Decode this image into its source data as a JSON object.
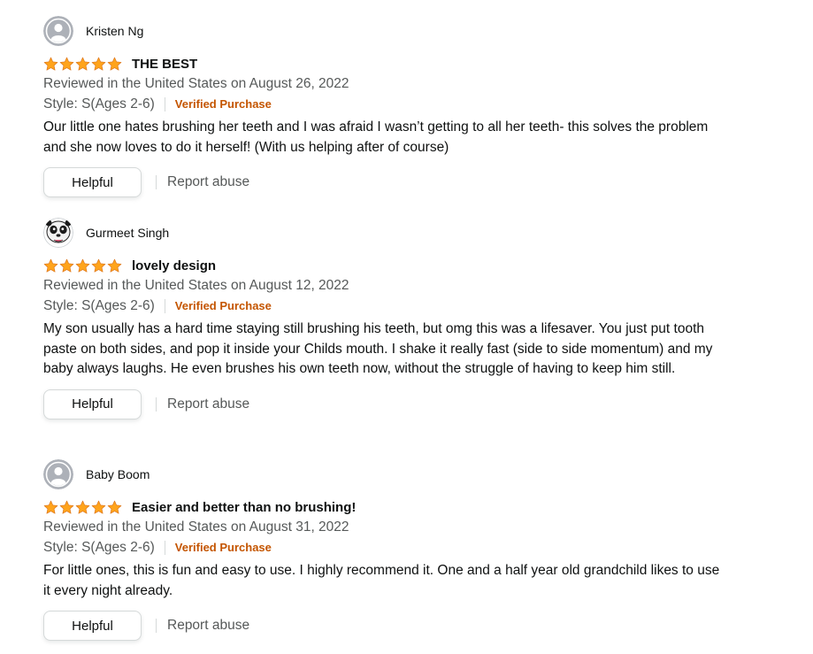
{
  "colors": {
    "star": "#ffa41c",
    "verified": "#c45500",
    "secondary_text": "#565959",
    "primary_text": "#0f1111"
  },
  "reviews": [
    {
      "profile_name": "Kristen Ng",
      "avatar_icon": "default-user-avatar-icon",
      "rating": 5,
      "rating_max": 5,
      "title": "THE BEST",
      "date": "Reviewed in the United States on August 26, 2022",
      "style": "Style: S(Ages 2-6)",
      "verified": "Verified Purchase",
      "body": "Our little one hates brushing her teeth and I was afraid I wasn’t getting to all her teeth- this solves the problem and she now loves to do it herself! (With us helping after of course)",
      "helpful_label": "Helpful",
      "report_label": "Report abuse"
    },
    {
      "profile_name": "Gurmeet Singh",
      "avatar_icon": "cartoon-panda-avatar-icon",
      "rating": 5,
      "rating_max": 5,
      "title": "lovely design",
      "date": "Reviewed in the United States on August 12, 2022",
      "style": "Style: S(Ages 2-6)",
      "verified": "Verified Purchase",
      "body": "My son usually has a hard time staying still brushing his teeth, but omg this was a lifesaver. You just put tooth paste on both sides, and pop it inside your Childs mouth. I shake it really fast (side to side momentum) and my baby always laughs. He even brushes his own teeth now, without the struggle of having to keep him still.",
      "helpful_label": "Helpful",
      "report_label": "Report abuse"
    },
    {
      "profile_name": "Baby Boom",
      "avatar_icon": "default-user-avatar-icon",
      "rating": 5,
      "rating_max": 5,
      "title": "Easier and better than no brushing!",
      "date": "Reviewed in the United States on August 31, 2022",
      "style": "Style: S(Ages 2-6)",
      "verified": "Verified Purchase",
      "body": "For little ones, this is fun and easy to use. I highly recommend it. One and a half year old grandchild likes to use it every night already.",
      "helpful_label": "Helpful",
      "report_label": "Report abuse"
    }
  ]
}
